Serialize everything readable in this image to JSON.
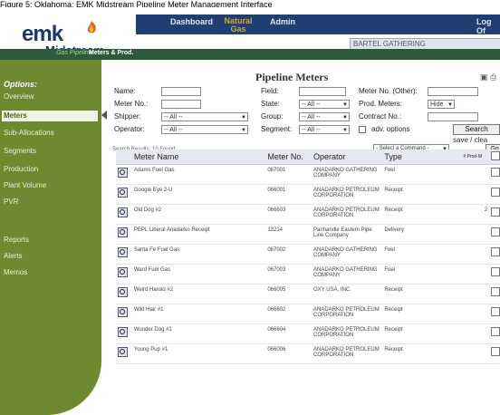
{
  "caption": "Figure 5: Oklahoma: EMK Midstream Pipeline Meter Management Interface",
  "brand": {
    "logo_text": "emk",
    "logo_sub": "Midstream"
  },
  "nav": {
    "dashboard": "Dashboard",
    "natural_gas": "Natural Gas",
    "admin": "Admin",
    "logoff": "Log Of"
  },
  "gathering": "BARTEL GATHERING",
  "breadcrumb": {
    "section": "Gas Pipeline",
    "current": "Meters & Prod."
  },
  "sidebar": {
    "title": "Options:",
    "items": [
      "Overview",
      "Meters",
      "Sub-Allocations",
      "Segments",
      "Production",
      "Plant Volume",
      "PVR"
    ],
    "items2": [
      "Reports",
      "Alerts",
      "Memos"
    ]
  },
  "page_title": "Pipeline Meters",
  "filters": {
    "name": "Name:",
    "meter_no": "Meter No.:",
    "shipper": "Shipper:",
    "operator": "Operator:",
    "shipper_val": "-- All --",
    "operator_val": "-- All --",
    "field": "Field:",
    "state": "State:",
    "group": "Group:",
    "segment": "Segment:",
    "state_val": "-- All --",
    "group_val": "-- All --",
    "segment_val": "-- All --",
    "meter_other": "Meter No. (Other):",
    "prod_meters": "Prod. Meters:",
    "prod_val": "Hide",
    "contract_no": "Contract No.:",
    "adv": "adv. options",
    "search": "Search",
    "save_clear": "save / clea"
  },
  "results": {
    "count": "Search Results: 10 Found",
    "command": "- Select a Command -",
    "go": "Go"
  },
  "table": {
    "headers": [
      "Meter Name",
      "Meter No.",
      "Operator",
      "Type",
      "# Prod-M"
    ],
    "rows": [
      {
        "name": "Adams Fuel Gas",
        "no": "067001",
        "op": "ANADARKO GATHERING COMPANY",
        "type": "Fuel",
        "prod": ""
      },
      {
        "name": "Google Eye 2-U",
        "no": "066001",
        "op": "ANADARKO PETROLEUM CORPORATION",
        "type": "Receipt",
        "prod": ""
      },
      {
        "name": "Old Dog #2",
        "no": "066603",
        "op": "ANADARKO PETROLEUM CORPORATION",
        "type": "Receipt",
        "prod": "2"
      },
      {
        "name": "PEPL Liberal Anadarko Receipt",
        "no": "13214",
        "op": "Panhandle Eastern Pipe Line Company",
        "type": "Delivery",
        "prod": ""
      },
      {
        "name": "Santa Fe Fuel Gas",
        "no": "067002",
        "op": "ANADARKO GATHERING COMPANY",
        "type": "Fuel",
        "prod": ""
      },
      {
        "name": "Ward Fuel Gas",
        "no": "067003",
        "op": "ANADARKO GATHERING COMPANY",
        "type": "Fuel",
        "prod": ""
      },
      {
        "name": "Weird Harold #2",
        "no": "066005",
        "op": "OXY USA, INC.",
        "type": "Receipt",
        "prod": ""
      },
      {
        "name": "Wild Hair #1",
        "no": "066602",
        "op": "ANADARKO PETROLEUM CORPORATION",
        "type": "Receipt",
        "prod": ""
      },
      {
        "name": "Wunder Dog #1",
        "no": "066604",
        "op": "ANADARKO PETROLEUM CORPORATION",
        "type": "Receipt",
        "prod": ""
      },
      {
        "name": "Young Pup #1",
        "no": "066006",
        "op": "ANADARKO PETROLEUM CORPORATION",
        "type": "Receipt",
        "prod": ""
      }
    ]
  },
  "colors": {
    "nav": "#1f3f72",
    "sidebar": "#6e8a31",
    "accent": "#d4a640"
  }
}
